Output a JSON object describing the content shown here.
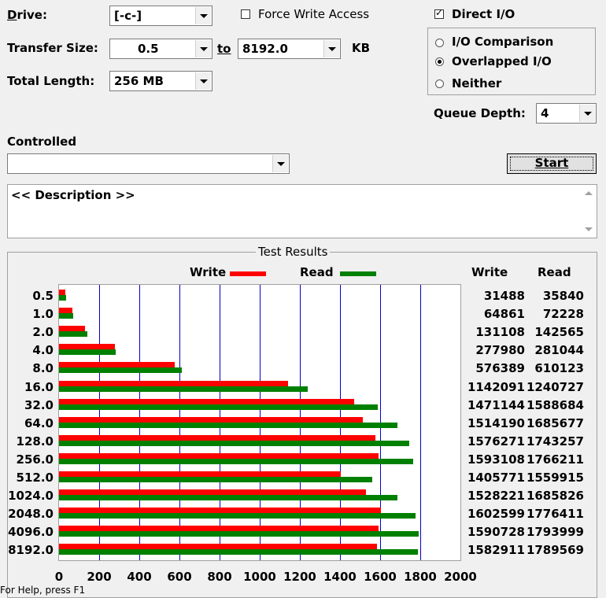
{
  "drive": {
    "label": "Drive:",
    "value": "[-c-]"
  },
  "transfer_size": {
    "label": "Transfer Size:",
    "from": "0.5",
    "to_label": "to",
    "to": "8192.0",
    "unit": "KB"
  },
  "total_length": {
    "label": "Total Length:",
    "value": "256 MB"
  },
  "force_write": {
    "label": "Force Write Access",
    "checked": false
  },
  "direct_io": {
    "label": "Direct I/O",
    "checked": true
  },
  "io_modes": [
    {
      "label": "I/O Comparison",
      "selected": false
    },
    {
      "label": "Overlapped I/O",
      "selected": true
    },
    {
      "label": "Neither",
      "selected": false
    }
  ],
  "queue_depth": {
    "label": "Queue Depth:",
    "value": "4"
  },
  "controlled": {
    "label": "Controlled",
    "value": ""
  },
  "start_button": "Start",
  "description": "<< Description >>",
  "results": {
    "title": "Test Results",
    "legend_write": "Write",
    "legend_read": "Read",
    "col_write": "Write",
    "col_read": "Read",
    "footer": "For Help, press F1"
  },
  "colors": {
    "write": "#ff0000",
    "read": "#008000",
    "grid": "#0000cc"
  },
  "chart_data": {
    "type": "bar",
    "orientation": "horizontal",
    "categories": [
      "0.5",
      "1.0",
      "2.0",
      "4.0",
      "8.0",
      "16.0",
      "32.0",
      "64.0",
      "128.0",
      "256.0",
      "512.0",
      "1024.0",
      "2048.0",
      "4096.0",
      "8192.0"
    ],
    "series": [
      {
        "name": "Write",
        "values": [
          31488,
          64861,
          131108,
          277980,
          576389,
          1142091,
          1471144,
          1514190,
          1576271,
          1593108,
          1405771,
          1528221,
          1602599,
          1590728,
          1582911
        ]
      },
      {
        "name": "Read",
        "values": [
          35840,
          72228,
          142565,
          281044,
          610123,
          1240727,
          1588684,
          1685677,
          1743257,
          1766211,
          1559915,
          1685826,
          1776411,
          1793999,
          1789569
        ]
      }
    ],
    "xticks": [
      "0",
      "200",
      "400",
      "600",
      "800",
      "1000",
      "1200",
      "1400",
      "1600",
      "1800",
      "2000"
    ],
    "xlim": [
      0,
      2000
    ],
    "unit_scale": 1000,
    "grid": true,
    "legend": "top"
  }
}
